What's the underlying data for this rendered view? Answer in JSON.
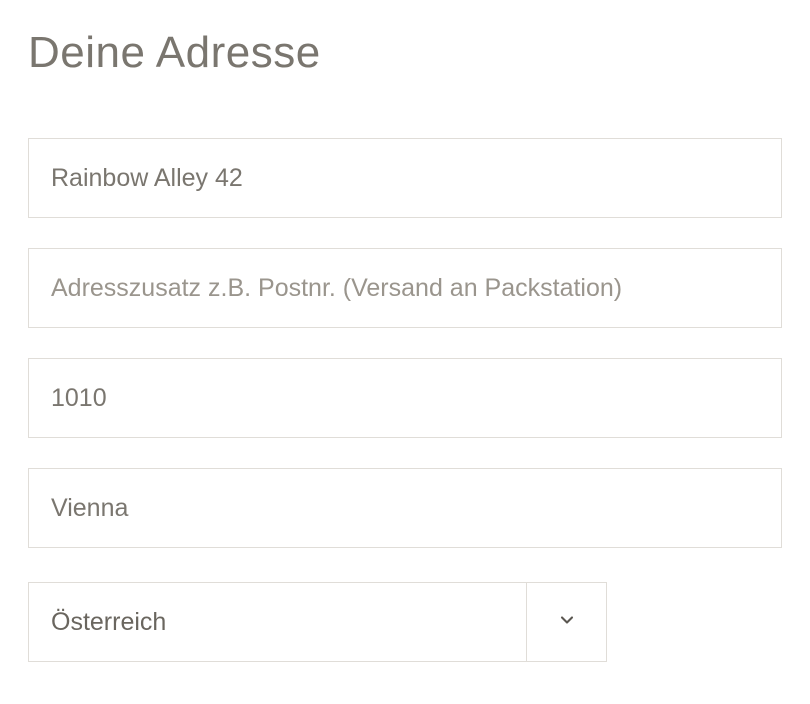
{
  "heading": "Deine Adresse",
  "fields": {
    "street": {
      "value": "Rainbow Alley 42",
      "placeholder": ""
    },
    "address_addition": {
      "value": "",
      "placeholder": "Adresszusatz z.B. Postnr. (Versand an Packstation)"
    },
    "postal_code": {
      "value": "1010",
      "placeholder": ""
    },
    "city": {
      "value": "Vienna",
      "placeholder": ""
    },
    "country": {
      "selected": "Österreich"
    }
  }
}
